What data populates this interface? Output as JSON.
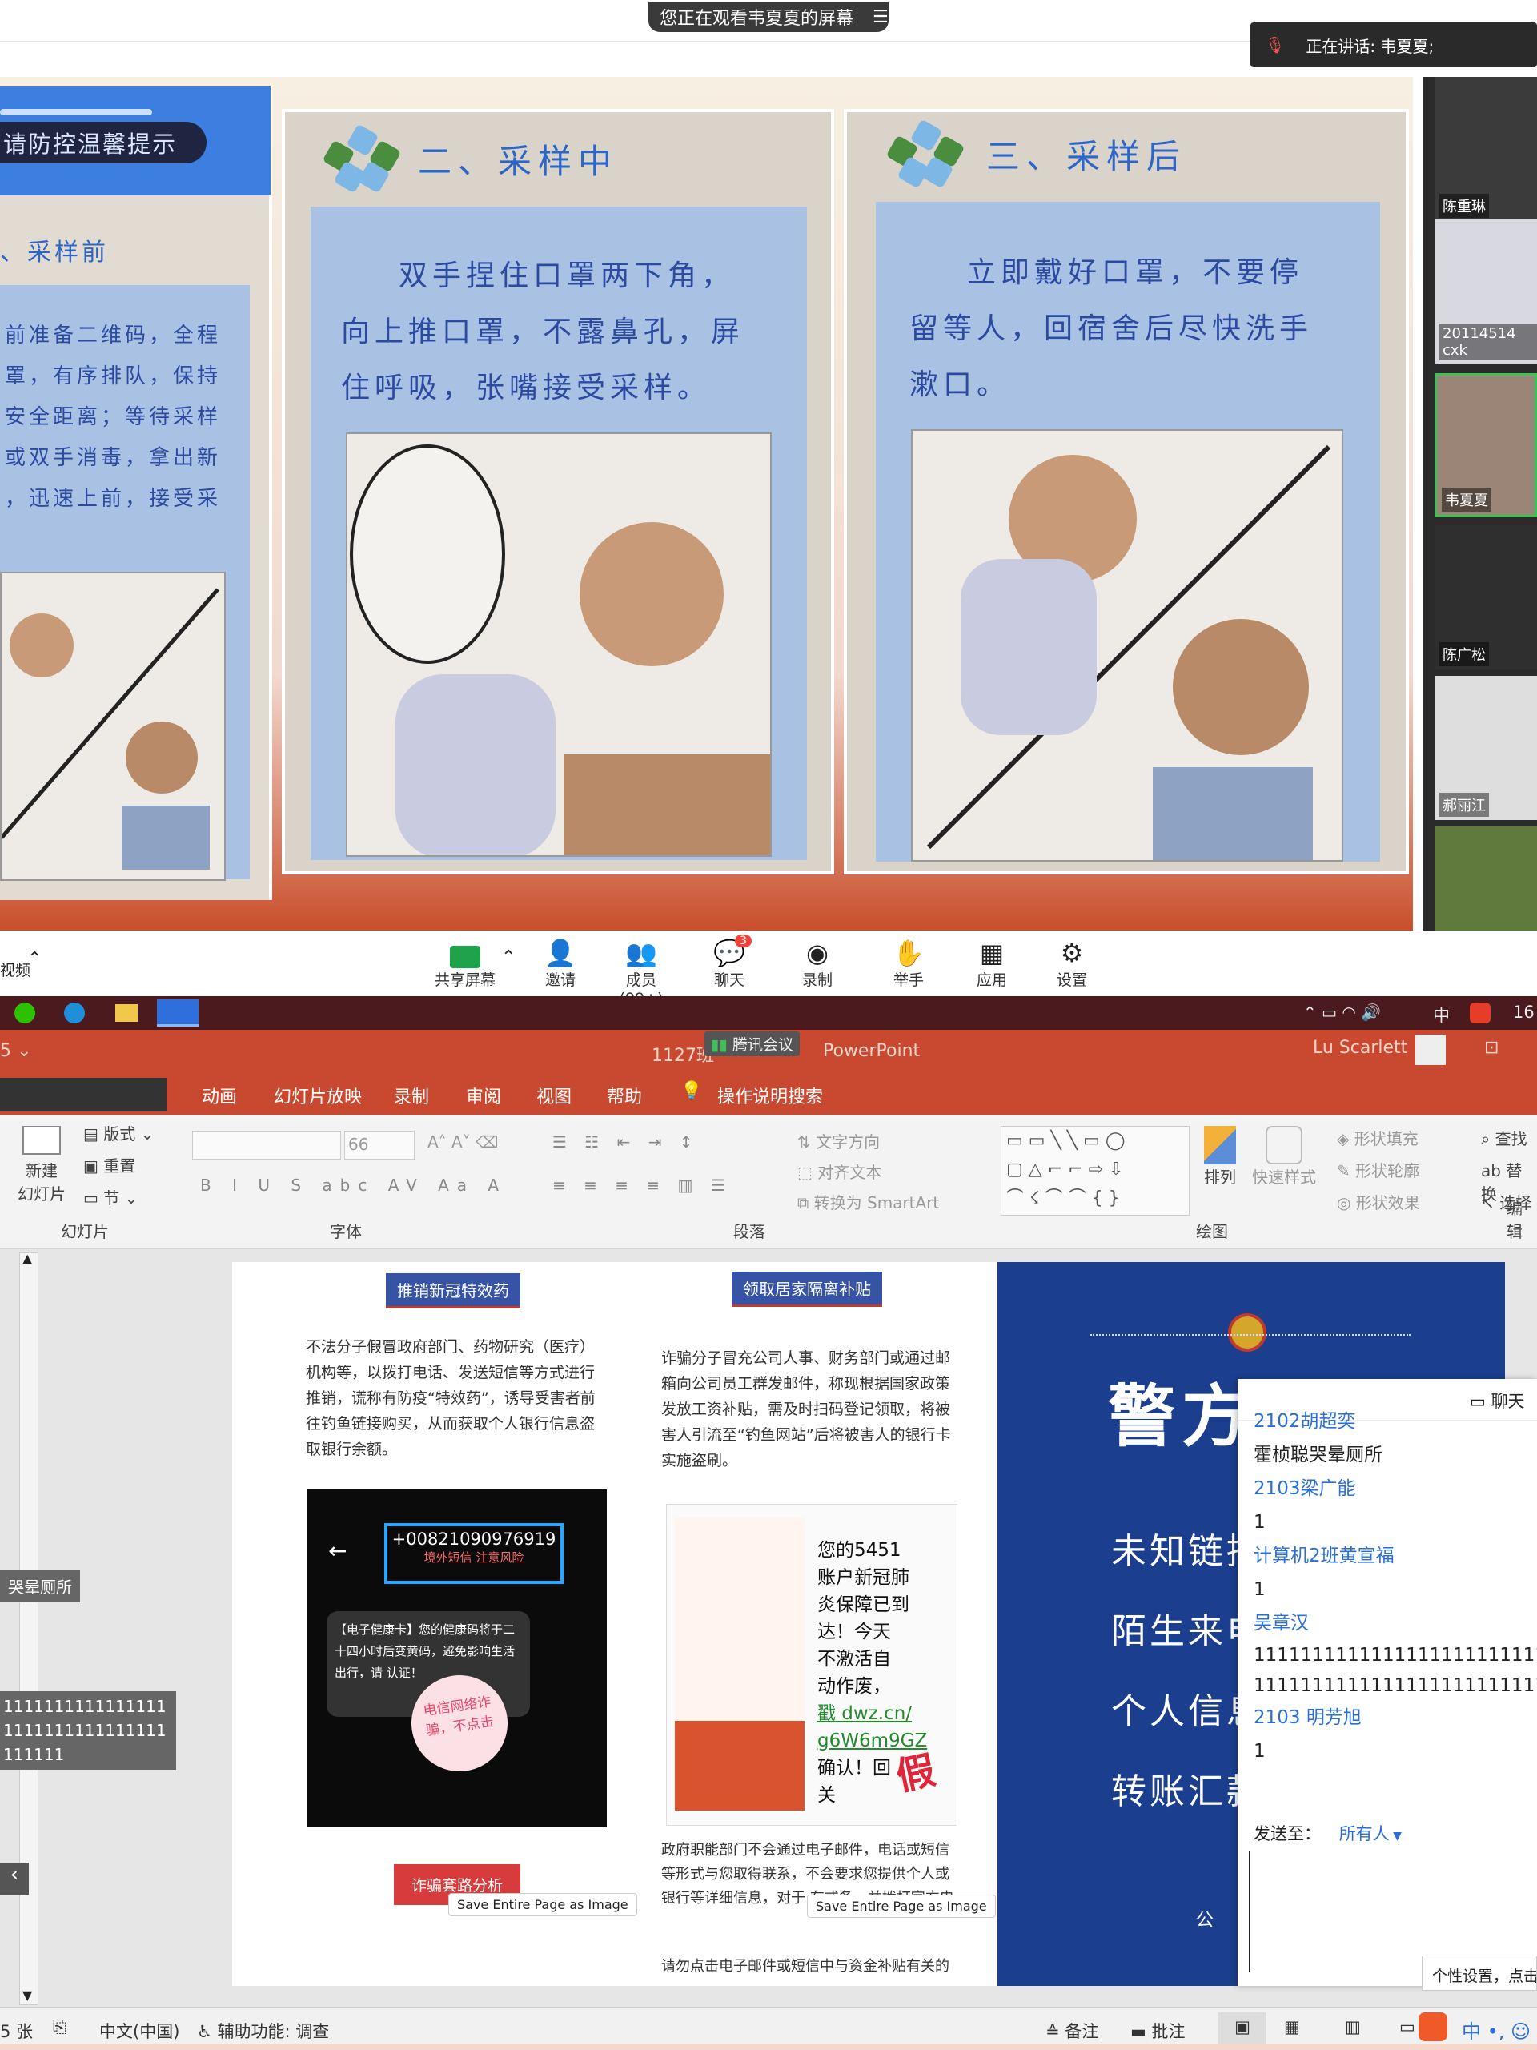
{
  "top_bar": {
    "screen_notice": "您正在观看韦夏夏的屏幕",
    "speaking_label": "正在讲话: 韦夏夏;"
  },
  "slide1": {
    "left_header": "请防控温馨提示",
    "left_section": "、采样前",
    "left_body": [
      "前准备二维码，全程",
      "罩，有序排队，保持",
      "安全距离；等待采样",
      "或双手消毒，拿出新",
      "，迅速上前，接受采"
    ],
    "mid_title": "二、采样中",
    "mid_body": [
      "双手捏住口罩两下角，",
      "向上推口罩，不露鼻孔，屏",
      "住呼吸，张嘴接受采样。"
    ],
    "right_title": "三、采样后",
    "right_body": [
      "立即戴好口罩，不要停",
      "留等人，回宿舍后尽快洗手",
      "漱口。"
    ]
  },
  "participants": [
    {
      "name": "陈重琳"
    },
    {
      "name": "20114514 cxk"
    },
    {
      "name": "韦夏夏"
    },
    {
      "name": "陈广松"
    },
    {
      "name": "郝丽江"
    }
  ],
  "meeting_toolbar": {
    "left_label": "视频",
    "buttons": [
      {
        "label": "共享屏幕",
        "icon": "share-screen-icon"
      },
      {
        "label": "邀请",
        "icon": "invite-icon"
      },
      {
        "label": "成员(99+)",
        "icon": "members-icon"
      },
      {
        "label": "聊天",
        "icon": "chat-icon",
        "badge": "3"
      },
      {
        "label": "录制",
        "icon": "record-icon"
      },
      {
        "label": "举手",
        "icon": "raise-hand-icon"
      },
      {
        "label": "应用",
        "icon": "apps-icon"
      },
      {
        "label": "设置",
        "icon": "settings-icon"
      }
    ]
  },
  "taskbar": {
    "ime": "中",
    "clock": "16"
  },
  "ppt": {
    "title": "1127班",
    "title_tail": "PowerPoint",
    "tencent_badge": "腾讯会议",
    "user": "Lu Scarlett",
    "menu": [
      "动画",
      "幻灯片放映",
      "录制",
      "审阅",
      "视图",
      "帮助",
      "操作说明搜索"
    ],
    "ribbon": {
      "slides_group": "幻灯片",
      "new_slide": "新建\n幻灯片",
      "layout": "版式",
      "reset": "重置",
      "section": "节",
      "font_group": "字体",
      "font_size": "66",
      "para_group": "段落",
      "text_direction": "文字方向",
      "align_text": "对齐文本",
      "smartart": "转换为 SmartArt",
      "drawing_group": "绘图",
      "arrange": "排列",
      "quick_styles": "快速样式",
      "shape_fill": "形状填充",
      "shape_outline": "形状轮廓",
      "shape_effects": "形状效果",
      "edit_group": "编辑",
      "find": "查找",
      "replace": "替换",
      "select": "选择"
    },
    "left_notes": [
      "哭晕厕所",
      "1111111111111111",
      "1111111111111111",
      "111111"
    ],
    "slide2": {
      "tag1": "推销新冠特效药",
      "col1_text": "不法分子假冒政府部门、药物研究（医疗）机构等，以拨打电话、发送短信等方式进行推销，谎称有防疫“特效药”，诱导受害者前往钓鱼链接购买，从而获取个人银行信息盗取银行余额。",
      "phone_number": "+00821090976919",
      "phone_sub": "境外短信 注意风险",
      "phone_msg": "【电子健康卡】您的健康码将于二十四小时后变黄码，避免影响生活出行，请      认证！",
      "bubble": "电信网络诈骗，不点击",
      "fraud_tag": "诈骗套路分析",
      "save1": "Save Entire Page as Image",
      "tag2": "领取居家隔离补贴",
      "col2_text": "诈骗分子冒充公司人事、财务部门或通过邮箱向公司员工群发邮件，称现根据国家政策发放工资补贴，需及时扫码登记领取，将被害人引流至“钓鱼网站”后将被害人的银行卡实施盗刷。",
      "sms": [
        "您的5451",
        "账户新冠肺",
        "炎保障已到",
        "达！今天",
        "不激活自",
        "动作废，",
        "戳 dwz.cn/",
        "g6W6m9GZ",
        "确认！回",
        "关"
      ],
      "fake": "假",
      "col2_text2": "政府职能部门不会通过电子邮件，电话或短信等形式与您取得联系，不会要求您提供个人或银行等详细信息，对于    存戒备，并拨打官方电",
      "col2_text3": "请勿点击电子邮件或短信中与资金补贴有关的",
      "save2": "Save Entire Page as Image",
      "police_title": "警方提示",
      "police_lines": [
        "未知链接",
        "陌生来电",
        "个人信息",
        "转账汇款"
      ],
      "police_footer": "公"
    }
  },
  "chat": {
    "title": "聊天",
    "messages": [
      {
        "name": "2102胡超奕",
        "text": "霍桢聪哭晕厕所"
      },
      {
        "name": "2103梁广能",
        "text": "1"
      },
      {
        "name": "计算机2班黄宣福",
        "text": "1"
      },
      {
        "name": "吴章汉",
        "text": "1111111111111111111111111\n1111111111111111111111111"
      },
      {
        "name": "2103 明芳旭",
        "text": "1"
      }
    ],
    "send_to": "发送至：",
    "recipient": "所有人",
    "personal_settings": "个性设置，点击"
  },
  "statusbar": {
    "slide_count": "5 张",
    "language": "中文(中国)",
    "accessibility": "辅助功能: 调查",
    "notes": "备注",
    "comments": "批注"
  },
  "colors": {
    "ppt_red": "#c8492f",
    "police_blue": "#1b3f8e",
    "slide_blue": "#a9c2e4",
    "accent_blue": "#2c66c8"
  }
}
